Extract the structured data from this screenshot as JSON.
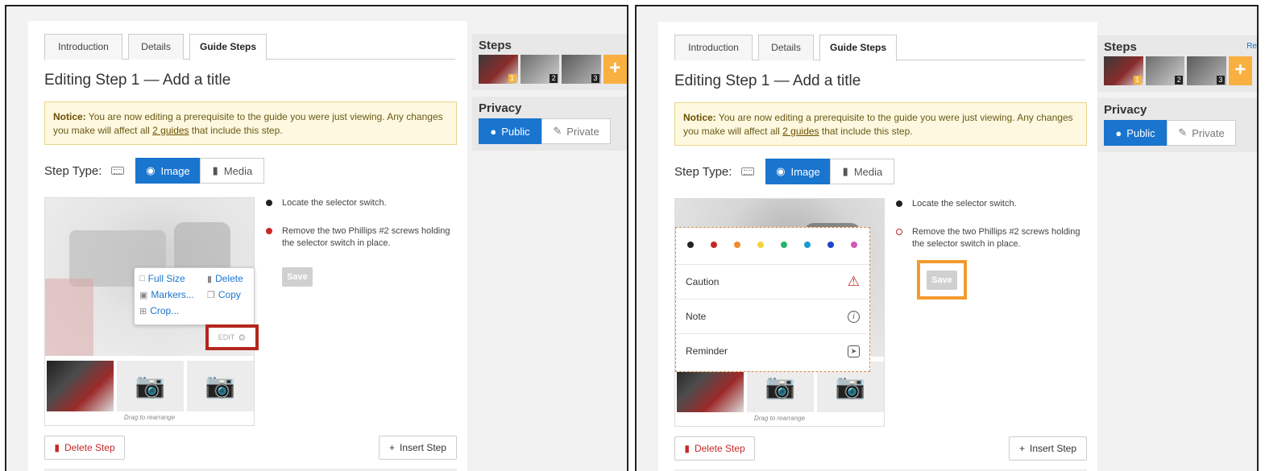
{
  "left": {
    "tabs": [
      "Introduction",
      "Details",
      "Guide Steps"
    ],
    "page_title": "Editing Step 1 — Add a title",
    "notice": {
      "bold": "Notice:",
      "text1": " You are now editing a prerequisite to the guide you were just viewing. Any changes you make will affect all ",
      "link": "2 guides",
      "text2": " that include this step."
    },
    "step_type_label": "Step Type:",
    "image_label": "Image",
    "media_label": "Media",
    "bullets": [
      "Locate the selector switch.",
      "Remove the two Phillips #2 screws holding the selector switch in place."
    ],
    "save_label": "Save",
    "drag_note": "Drag to rearrange",
    "edit_menu": {
      "full_size": "Full Size",
      "delete": "Delete",
      "markers": "Markers...",
      "copy": "Copy",
      "crop": "Crop..."
    },
    "edit_label": "EDIT",
    "delete_step": "Delete Step",
    "insert_step": "Insert Step",
    "sidebar": {
      "steps_title": "Steps",
      "thumb_numbers": [
        "1",
        "2",
        "3"
      ],
      "add": "+",
      "privacy_title": "Privacy",
      "public": "Public",
      "private": "Private"
    }
  },
  "right": {
    "tabs": [
      "Introduction",
      "Details",
      "Guide Steps"
    ],
    "page_title": "Editing Step 1 — Add a title",
    "notice": {
      "bold": "Notice:",
      "text1": " You are now editing a prerequisite to the guide you were just viewing. Any changes you make will affect all ",
      "link": "2 guides",
      "text2": " that include this step."
    },
    "step_type_label": "Step Type:",
    "image_label": "Image",
    "media_label": "Media",
    "bullets": [
      "Locate the selector switch.",
      "Remove the two Phillips #2 screws holding the selector switch in place."
    ],
    "save_label": "Save",
    "drag_note": "Drag to rearrange",
    "marker_colors": [
      "#222222",
      "#c62828",
      "#f28b30",
      "#f2d33c",
      "#26b36b",
      "#1a9bd1",
      "#2046c8",
      "#d05ab7"
    ],
    "marker_options": [
      "Caution",
      "Note",
      "Reminder"
    ],
    "delete_step": "Delete Step",
    "insert_step": "Insert Step",
    "sidebar": {
      "steps_title": "Steps",
      "link_fragment": "Re",
      "thumb_numbers": [
        "1",
        "2",
        "3"
      ],
      "add": "+",
      "privacy_title": "Privacy",
      "public": "Public",
      "private": "Private"
    }
  }
}
